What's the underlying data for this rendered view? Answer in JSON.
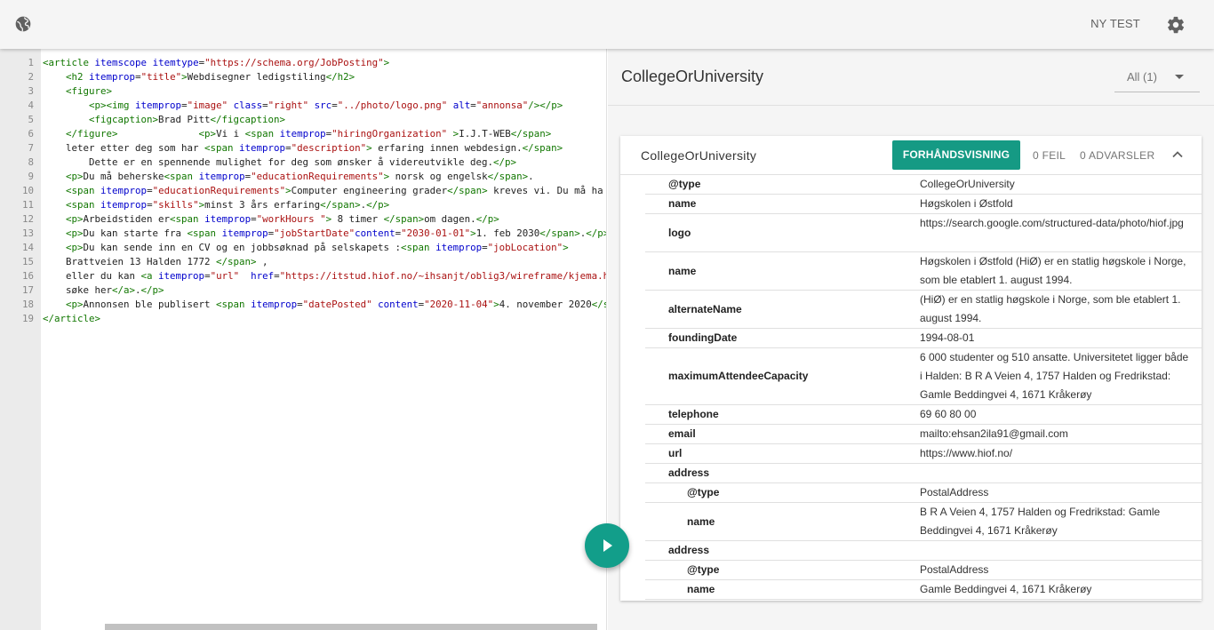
{
  "topbar": {
    "globe_icon": "globe-icon",
    "new_test_label": "NY TEST",
    "settings_icon": "gear-icon"
  },
  "editor": {
    "lines": [
      {
        "n": "1",
        "html": "<span class='tag'>&lt;article</span> <span class='attr'>itemscope</span> <span class='attr'>itemtype</span>=<span class='str'>\"https://schema.org/JobPosting\"</span><span class='tag'>&gt;</span>"
      },
      {
        "n": "2",
        "html": "    <span class='tag'>&lt;h2</span> <span class='attr'>itemprop</span>=<span class='str'>\"title\"</span><span class='tag'>&gt;</span>Webdisegner ledigstiling<span class='tag'>&lt;/h2&gt;</span>"
      },
      {
        "n": "3",
        "html": "    <span class='tag'>&lt;figure&gt;</span>"
      },
      {
        "n": "4",
        "html": "        <span class='tag'>&lt;p&gt;&lt;img</span> <span class='attr'>itemprop</span>=<span class='str'>\"image\"</span> <span class='attr'>class</span>=<span class='str'>\"right\"</span> <span class='attr'>src</span>=<span class='str'>\"../photo/logo.png\"</span> <span class='attr'>alt</span>=<span class='str'>\"annonsa\"</span><span class='tag'>/&gt;&lt;/p&gt;</span>"
      },
      {
        "n": "5",
        "html": "        <span class='tag'>&lt;figcaption&gt;</span>Brad Pitt<span class='tag'>&lt;/figcaption&gt;</span>"
      },
      {
        "n": "6",
        "html": "    <span class='tag'>&lt;/figure&gt;</span>              <span class='tag'>&lt;p&gt;</span>Vi i <span class='tag'>&lt;span</span> <span class='attr'>itemprop</span>=<span class='str'>\"hiringOrganization\"</span> <span class='tag'>&gt;</span>I.J.T-WEB<span class='tag'>&lt;/span&gt;</span>"
      },
      {
        "n": "7",
        "html": "    leter etter deg som har <span class='tag'>&lt;span</span> <span class='attr'>itemprop</span>=<span class='str'>\"description\"</span><span class='tag'>&gt;</span> erfaring innen webdesign.<span class='tag'>&lt;/span&gt;</span>"
      },
      {
        "n": "8",
        "html": "        Dette er en spennende mulighet for deg som ønsker å videreutvikle deg.<span class='tag'>&lt;/p&gt;</span>"
      },
      {
        "n": "9",
        "html": "    <span class='tag'>&lt;p&gt;</span>Du må beherske<span class='tag'>&lt;span</span> <span class='attr'>itemprop</span>=<span class='str'>\"educationRequirements\"</span><span class='tag'>&gt;</span> norsk og engelsk<span class='tag'>&lt;/span&gt;</span>."
      },
      {
        "n": "10",
        "html": "    <span class='tag'>&lt;span</span> <span class='attr'>itemprop</span>=<span class='str'>\"educationRequirements\"</span><span class='tag'>&gt;</span>Computer engineering grader<span class='tag'>&lt;/span&gt;</span> kreves vi. Du må ha"
      },
      {
        "n": "11",
        "html": "    <span class='tag'>&lt;span</span> <span class='attr'>itemprop</span>=<span class='str'>\"skills\"</span><span class='tag'>&gt;</span>minst 3 års erfaring<span class='tag'>&lt;/span&gt;</span>.<span class='tag'>&lt;/p&gt;</span>"
      },
      {
        "n": "12",
        "html": "    <span class='tag'>&lt;p&gt;</span>Arbeidstiden er<span class='tag'>&lt;span</span> <span class='attr'>itemprop</span>=<span class='str'>\"workHours \"</span><span class='tag'>&gt;</span> 8 timer <span class='tag'>&lt;/span&gt;</span>om dagen.<span class='tag'>&lt;/p&gt;</span>"
      },
      {
        "n": "13",
        "html": "    <span class='tag'>&lt;p&gt;</span>Du kan starte fra <span class='tag'>&lt;span</span> <span class='attr'>itemprop</span>=<span class='str'>\"jobStartDate\"</span><span class='attr'>content</span>=<span class='str'>\"2030-01-01\"</span><span class='tag'>&gt;</span>1. feb 2030<span class='tag'>&lt;/span&gt;</span>.<span class='tag'>&lt;/p&gt;</span>"
      },
      {
        "n": "14",
        "html": "    <span class='tag'>&lt;p&gt;</span>Du kan sende inn en CV og en jobbsøknad på selskapets :<span class='tag'>&lt;span</span> <span class='attr'>itemprop</span>=<span class='str'>\"jobLocation\"</span><span class='tag'>&gt;</span>"
      },
      {
        "n": "15",
        "html": "    Brattveien 13 Halden 1772 <span class='tag'>&lt;/span&gt;</span> ,"
      },
      {
        "n": "16",
        "html": "    eller du kan <span class='tag'>&lt;a</span> <span class='attr'>itemprop</span>=<span class='str'>\"url\"</span>  <span class='attr'>href</span>=<span class='str'>\"https://itstud.hiof.no/~ihsanjt/oblig3/wireframe/kjema.ht</span>"
      },
      {
        "n": "17",
        "html": "    søke her<span class='tag'>&lt;/a&gt;</span>.<span class='tag'>&lt;/p&gt;</span>"
      },
      {
        "n": "18",
        "html": "    <span class='tag'>&lt;p&gt;</span>Annonsen ble publisert <span class='tag'>&lt;span</span> <span class='attr'>itemprop</span>=<span class='str'>\"datePosted\"</span> <span class='attr'>content</span>=<span class='str'>\"2020-11-04\"</span><span class='tag'>&gt;</span>4. november 2020<span class='tag'>&lt;/sp</span>"
      },
      {
        "n": "19",
        "html": "<span class='tag'>&lt;/article&gt;</span>"
      }
    ]
  },
  "run_button_icon": "play-icon",
  "results": {
    "title": "CollegeOrUniversity",
    "filter_label": "All (1)",
    "card": {
      "title": "CollegeOrUniversity",
      "preview_label": "FORHÅNDSVISNING",
      "errors": "0 FEIL",
      "warnings": "0 ADVARSLER",
      "collapse_icon": "chevron-up-icon"
    },
    "rows": [
      {
        "key": "@type",
        "value": "CollegeOrUniversity",
        "nested": false,
        "lines": 1
      },
      {
        "key": "name",
        "value": "Høgskolen i Østfold",
        "nested": false,
        "lines": 1
      },
      {
        "key": "logo",
        "value": "https://search.google.com/structured-data/photo/hiof.jpg",
        "nested": false,
        "lines": 2
      },
      {
        "key": "name",
        "value": "Høgskolen i Østfold (HiØ) er en statlig høgskole i Norge, som ble etablert 1. august 1994.",
        "nested": false,
        "lines": 2
      },
      {
        "key": "alternateName",
        "value": "(HiØ) er en statlig høgskole i Norge, som ble etablert 1. august 1994.",
        "nested": false,
        "lines": 2
      },
      {
        "key": "foundingDate",
        "value": "1994-08-01",
        "nested": false,
        "lines": 1
      },
      {
        "key": "maximumAttendeeCapacity",
        "value": "6 000 studenter og 510 ansatte. Universitetet ligger både i Halden: B R A Veien 4, 1757 Halden og Fredrikstad: Gamle Beddingvei 4, 1671 Kråkerøy",
        "nested": false,
        "lines": 3
      },
      {
        "key": "telephone",
        "value": "69 60 80 00",
        "nested": false,
        "lines": 1
      },
      {
        "key": "email",
        "value": "mailto:ehsan2ila91@gmail.com",
        "nested": false,
        "lines": 1
      },
      {
        "key": "url",
        "value": "https://www.hiof.no/",
        "nested": false,
        "lines": 1
      },
      {
        "key": "address",
        "value": "",
        "nested": false,
        "lines": 1
      },
      {
        "key": "@type",
        "value": "PostalAddress",
        "nested": true,
        "lines": 1
      },
      {
        "key": "name",
        "value": "B R A Veien 4, 1757 Halden og Fredrikstad: Gamle Beddingvei 4, 1671 Kråkerøy",
        "nested": true,
        "lines": 2
      },
      {
        "key": "address",
        "value": "",
        "nested": false,
        "lines": 1
      },
      {
        "key": "@type",
        "value": "PostalAddress",
        "nested": true,
        "lines": 1
      },
      {
        "key": "name",
        "value": "Gamle Beddingvei 4, 1671 Kråkerøy",
        "nested": true,
        "lines": 1
      }
    ]
  }
}
